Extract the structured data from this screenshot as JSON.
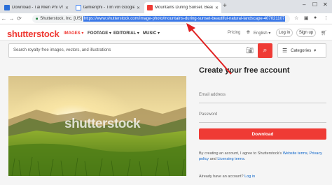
{
  "browser": {
    "tabs": [
      {
        "title": "Download - Tải Miễn Phí VN - Ph",
        "fav_color": "#2a6ed8"
      },
      {
        "title": "taimienphi - Tìm với Google",
        "fav_color": "#ffffff"
      },
      {
        "title": "Mountains During Sunset. Beautif",
        "fav_color": "#ef3b35"
      }
    ],
    "new_tab": "+",
    "address": {
      "site_label": "Shutterstock, Inc. [US]",
      "url": "https://www.shutterstock.com/image-photo/mountains-during-sunset-beautiful-natural-landscape-407021107"
    }
  },
  "header": {
    "logo": "shutterstock",
    "nav": [
      "IMAGES ▾",
      "FOOTAGE ▾",
      "EDITORIAL ▾",
      "MUSIC ▾"
    ],
    "pricing": "Pricing",
    "language": "English ▾",
    "login": "Log in",
    "signup": "Sign up"
  },
  "search": {
    "placeholder": "Search royalty-free images, vectors, and illustrations",
    "categories": "Categories"
  },
  "photo": {
    "watermark": "shutterstock"
  },
  "form": {
    "title": "Create your free account",
    "email_label": "Email address",
    "password_label": "Password",
    "download_button": "Download",
    "terms_prefix": "By creating an account, I agree to Shutterstock's",
    "terms_link1": "Website terms",
    "terms_sep": ",",
    "terms_link2": "Privacy policy",
    "terms_and": "and",
    "terms_link3": "Licensing terms",
    "terms_end": ".",
    "already_text": "Already have an account?",
    "login_link": "Log in"
  },
  "colors": {
    "brand": "#ef3b35",
    "link": "#0a63c9",
    "annotation_arrow": "#e02020"
  }
}
